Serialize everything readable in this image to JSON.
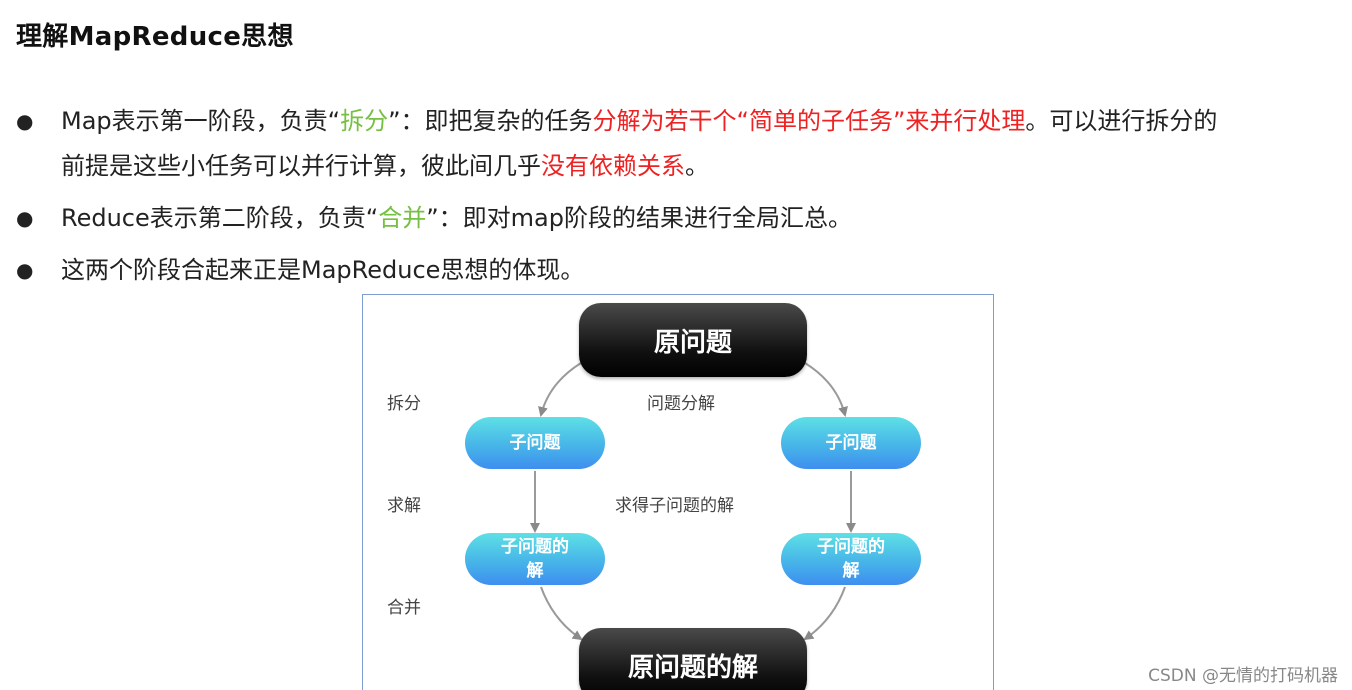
{
  "title": "理解MapReduce思想",
  "bullets": [
    {
      "line1": [
        {
          "text": "Map表示第一阶段，负责“",
          "style": "normal"
        },
        {
          "text": "拆分",
          "style": "green"
        },
        {
          "text": "”：即把复杂的任务",
          "style": "normal"
        },
        {
          "text": "分解为若干个“简单的子任务”来并行处理",
          "style": "red"
        },
        {
          "text": "。可以进行拆分的",
          "style": "normal"
        }
      ],
      "line2": [
        {
          "text": "前提是这些小任务可以并行计算，彼此间几乎",
          "style": "normal"
        },
        {
          "text": "没有依赖关系",
          "style": "red"
        },
        {
          "text": "。",
          "style": "normal"
        }
      ]
    },
    {
      "line1": [
        {
          "text": "Reduce表示第二阶段，负责“",
          "style": "normal"
        },
        {
          "text": "合并",
          "style": "green"
        },
        {
          "text": "”：即对map阶段的结果进行全局汇总。",
          "style": "normal"
        }
      ]
    },
    {
      "line1": [
        {
          "text": "这两个阶段合起来正是MapReduce思想的体现。",
          "style": "normal"
        }
      ]
    }
  ],
  "bullet_symbol": "●",
  "diagram": {
    "top_node": "原问题",
    "bottom_node": "原问题的解",
    "left_labels": {
      "split": "拆分",
      "solve": "求解",
      "merge": "合并"
    },
    "center_labels": {
      "decompose": "问题分解",
      "solve_sub": "求得子问题的解"
    },
    "sub_problem": "子问题",
    "sub_solution_line1": "子问题的",
    "sub_solution_line2": "解"
  },
  "watermark": "CSDN @无情的打码机器",
  "colors": {
    "green": "#76c043",
    "red": "#ee2222",
    "frame": "#7d9cd0"
  }
}
